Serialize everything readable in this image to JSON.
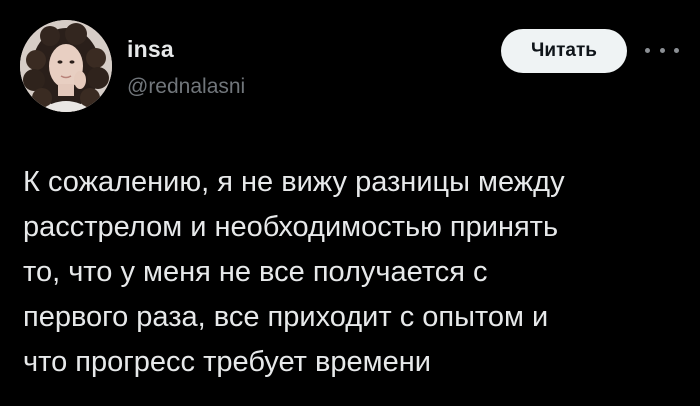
{
  "author": {
    "display_name": "insa",
    "handle": "@rednalasni",
    "avatar_icon": "profile-photo"
  },
  "actions": {
    "follow_label": "Читать",
    "more_icon": "more-horizontal-icon"
  },
  "tweet": {
    "lines": [
      "К сожалению, я не вижу разницы между",
      "расстрелом и необходимостью принять",
      "то, что у меня не все получается с",
      "первого раза, все приходит с опытом и",
      "что прогресс требует времени"
    ]
  },
  "colors": {
    "background": "#000000",
    "primary_text": "#e7e9ea",
    "secondary_text": "#71767b",
    "button_bg": "#eff3f4",
    "button_text": "#0f1419"
  }
}
